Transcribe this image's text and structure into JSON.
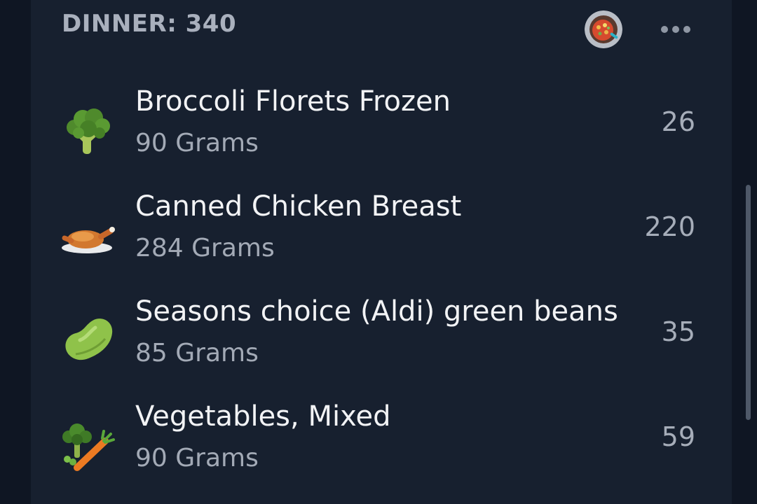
{
  "meal": {
    "title": "DINNER: 340",
    "photo_icon": "meal-photo-thumbnail",
    "more_icon": "more-horizontal-icon"
  },
  "items": [
    {
      "name": "Broccoli Florets Frozen",
      "serving": "90 Grams",
      "calories": "26",
      "icon": "broccoli-icon"
    },
    {
      "name": "Canned Chicken Breast",
      "serving": "284 Grams",
      "calories": "220",
      "icon": "roast-chicken-icon"
    },
    {
      "name": "Seasons choice (Aldi) green beans",
      "serving": "85 Grams",
      "calories": "35",
      "icon": "bean-icon"
    },
    {
      "name": "Vegetables, Mixed",
      "serving": "90 Grams",
      "calories": "59",
      "icon": "mixed-vegetables-icon"
    }
  ],
  "colors": {
    "background": "#121a27",
    "card": "#17202f",
    "primary_text": "#f2f3f5",
    "secondary_text": "#a3aab6"
  }
}
